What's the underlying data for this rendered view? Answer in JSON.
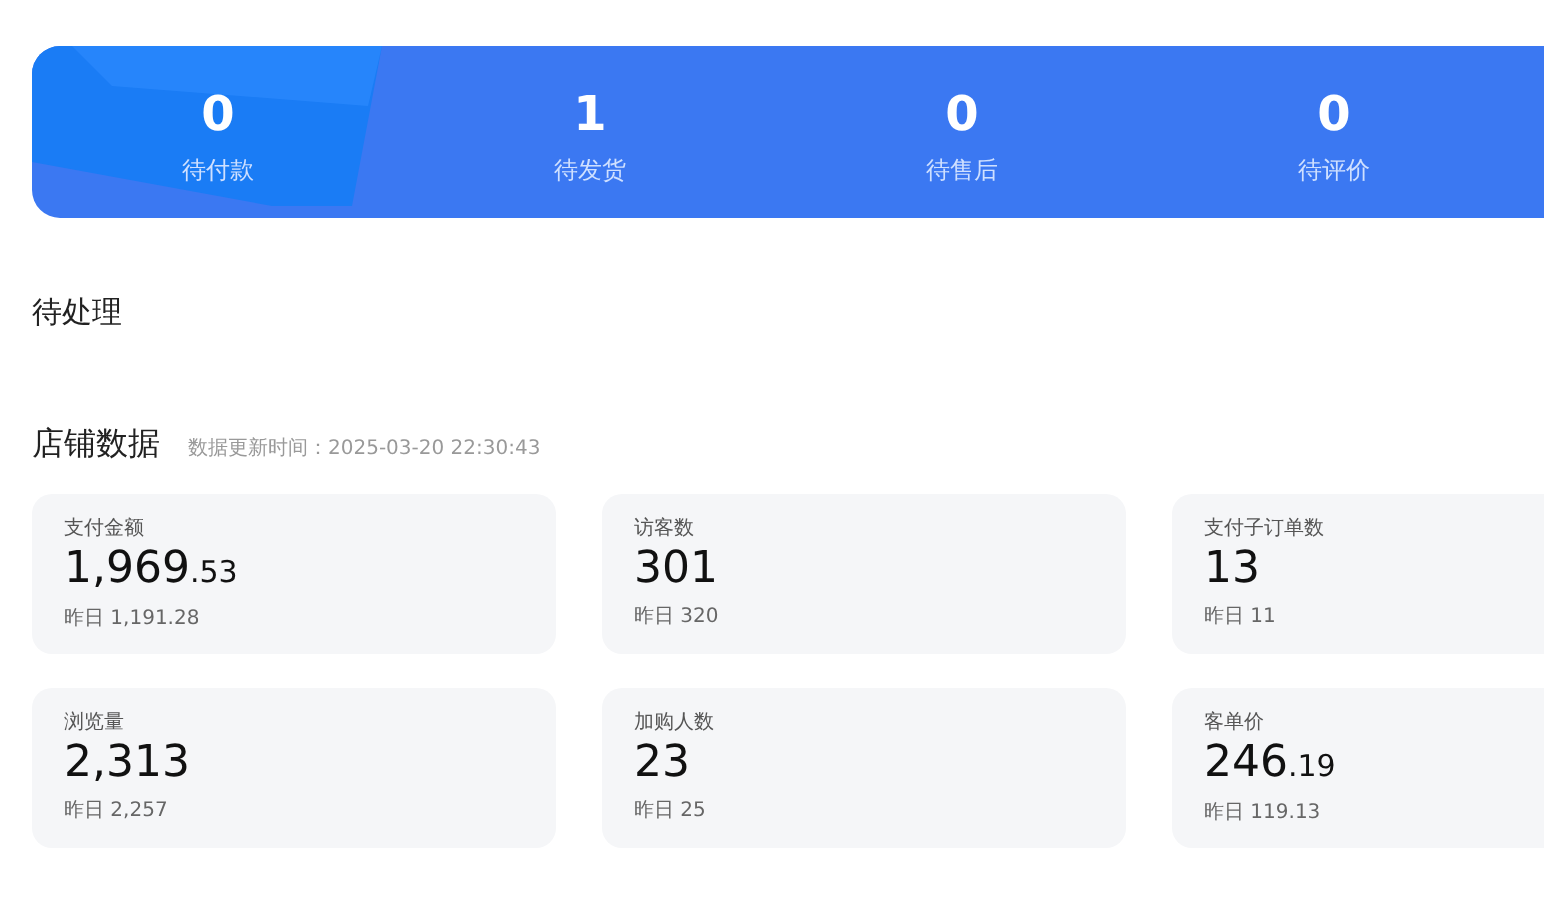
{
  "order_summary": [
    {
      "count": "0",
      "label": "待付款"
    },
    {
      "count": "1",
      "label": "待发货"
    },
    {
      "count": "0",
      "label": "待售后"
    },
    {
      "count": "0",
      "label": "待评价"
    }
  ],
  "pending": {
    "title": "待处理"
  },
  "store_data": {
    "title": "店铺数据",
    "updated": "数据更新时间：2025-03-20 22:30:43",
    "metrics": [
      {
        "label": "支付金额",
        "value": "1,969",
        "fraction": ".53",
        "yesterday": "昨日 1,191.28"
      },
      {
        "label": "访客数",
        "value": "301",
        "yesterday": "昨日 320"
      },
      {
        "label": "支付子订单数",
        "value": "13",
        "yesterday": "昨日 11"
      },
      {
        "label": "浏览量",
        "value": "2,313",
        "yesterday": "昨日 2,257"
      },
      {
        "label": "加购人数",
        "value": "23",
        "yesterday": "昨日 25"
      },
      {
        "label": "客单价",
        "value": "246",
        "fraction": ".19",
        "yesterday": "昨日 119.13"
      }
    ]
  }
}
